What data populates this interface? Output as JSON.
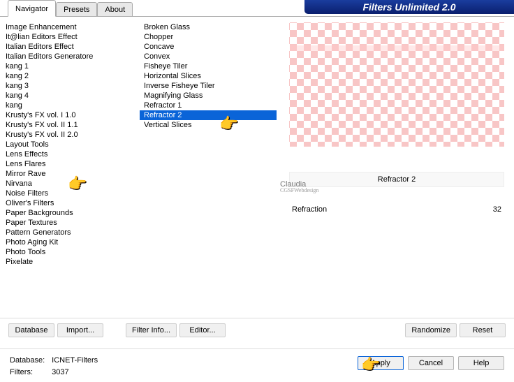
{
  "title": "Filters Unlimited 2.0",
  "tabs": [
    "Navigator",
    "Presets",
    "About"
  ],
  "categories": [
    "Image Enhancement",
    "It@lian Editors Effect",
    "Italian Editors Effect",
    "Italian Editors Generatore",
    "kang 1",
    "kang 2",
    "kang 3",
    "kang 4",
    "kang",
    "Krusty's FX vol. I 1.0",
    "Krusty's FX vol. II 1.1",
    "Krusty's FX vol. II 2.0",
    "Layout Tools",
    "Lens Effects",
    "Lens Flares",
    "Mirror Rave",
    "Nirvana",
    "Noise Filters",
    "Oliver's Filters",
    "Paper Backgrounds",
    "Paper Textures",
    "Pattern Generators",
    "Photo Aging Kit",
    "Photo Tools",
    "Pixelate"
  ],
  "filters": [
    "Broken Glass",
    "Chopper",
    "Concave",
    "Convex",
    "Fisheye Tiler",
    "Horizontal Slices",
    "Inverse Fisheye Tiler",
    "Magnifying Glass",
    "Refractor 1",
    "Refractor 2",
    "Vertical Slices"
  ],
  "selected_filter": "Refractor 2",
  "filter_name": "Refractor 2",
  "param_label": "Refraction",
  "param_value": "32",
  "watermark": "Claudia",
  "watermark_sub": "CGSFWebdesign",
  "buttons": {
    "database": "Database",
    "import": "Import...",
    "filterinfo": "Filter Info...",
    "editor": "Editor...",
    "randomize": "Randomize",
    "reset": "Reset",
    "apply": "Apply",
    "cancel": "Cancel",
    "help": "Help"
  },
  "db_label": "Database:",
  "db_value": "ICNET-Filters",
  "fc_label": "Filters:",
  "fc_value": "3037"
}
